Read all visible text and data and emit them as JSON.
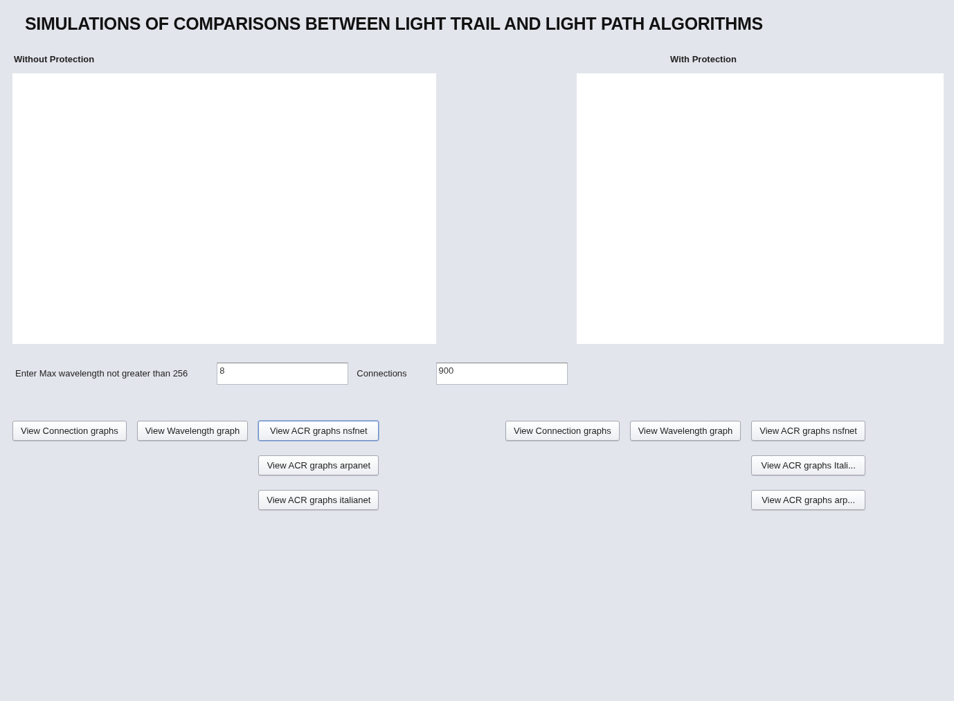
{
  "title": "SIMULATIONS OF COMPARISONS BETWEEN LIGHT TRAIL AND LIGHT PATH ALGORITHMS",
  "panels": [
    {
      "label": "Without Protection"
    },
    {
      "label": "With Protection"
    }
  ],
  "inputs": [
    {
      "label": "Enter Max wavelength not greater than 256",
      "value": "8"
    },
    {
      "label": "Connections",
      "value": "900"
    }
  ],
  "button_groups": [
    {
      "columns": [
        {
          "buttons": [
            {
              "label": "View Connection graphs",
              "focused": false
            }
          ]
        },
        {
          "buttons": [
            {
              "label": "View Wavelength graph",
              "focused": false
            }
          ]
        },
        {
          "buttons": [
            {
              "label": "View ACR graphs nsfnet",
              "focused": true
            },
            {
              "label": "View ACR graphs arpanet",
              "focused": false
            },
            {
              "label": "View ACR graphs italianet",
              "focused": false
            }
          ]
        }
      ]
    },
    {
      "columns": [
        {
          "buttons": [
            {
              "label": "View Connection graphs",
              "focused": false
            }
          ]
        },
        {
          "buttons": [
            {
              "label": "View Wavelength graph",
              "focused": false
            }
          ]
        },
        {
          "buttons": [
            {
              "label": "View ACR graphs nsfnet",
              "focused": false
            },
            {
              "label": "View ACR graphs Itali...",
              "focused": false
            },
            {
              "label": "View ACR graphs arp...",
              "focused": false
            }
          ]
        }
      ]
    }
  ]
}
